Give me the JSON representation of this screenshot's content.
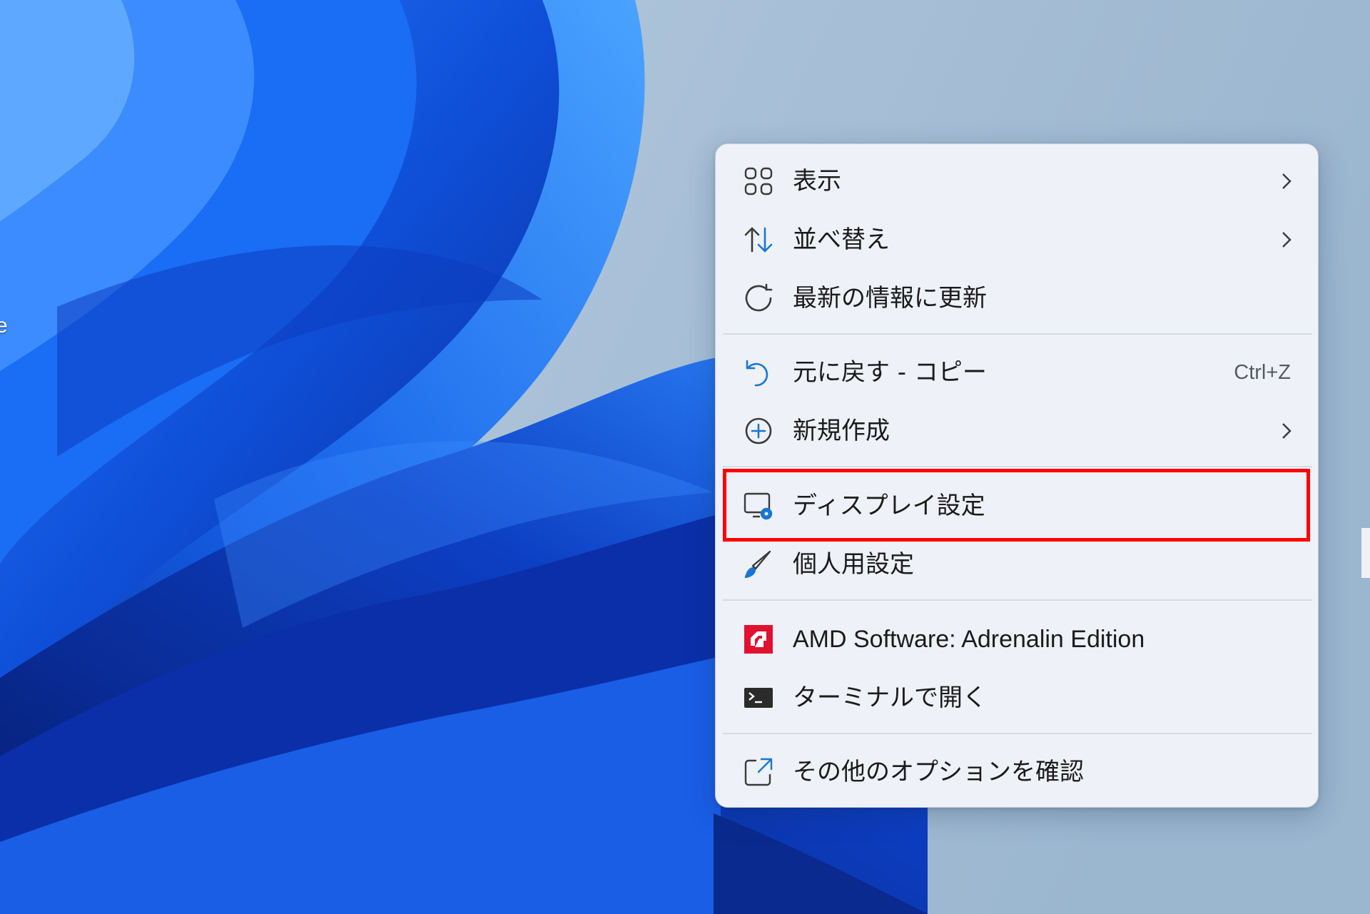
{
  "desktop": {
    "edge_text": "e"
  },
  "context_menu": {
    "items": [
      {
        "label": "表示",
        "icon": "grid-view-icon",
        "submenu": true
      },
      {
        "label": "並べ替え",
        "icon": "sort-arrows-icon",
        "submenu": true
      },
      {
        "label": "最新の情報に更新",
        "icon": "refresh-icon",
        "submenu": false
      },
      {
        "label": "元に戻す - コピー",
        "icon": "undo-icon",
        "shortcut": "Ctrl+Z"
      },
      {
        "label": "新規作成",
        "icon": "add-circle-icon",
        "submenu": true
      },
      {
        "label": "ディスプレイ設定",
        "icon": "display-settings-icon",
        "submenu": false,
        "highlighted": true
      },
      {
        "label": "個人用設定",
        "icon": "paintbrush-icon",
        "submenu": false
      },
      {
        "label": "AMD Software: Adrenalin Edition",
        "icon": "amd-logo-icon",
        "submenu": false
      },
      {
        "label": "ターミナルで開く",
        "icon": "terminal-icon",
        "submenu": false
      },
      {
        "label": "その他のオプションを確認",
        "icon": "more-options-icon",
        "submenu": false
      }
    ]
  },
  "colors": {
    "highlight_border": "#ff0000",
    "menu_background": "#eef1f7",
    "accent_blue": "#1976d2",
    "amd_red": "#e1112f"
  }
}
